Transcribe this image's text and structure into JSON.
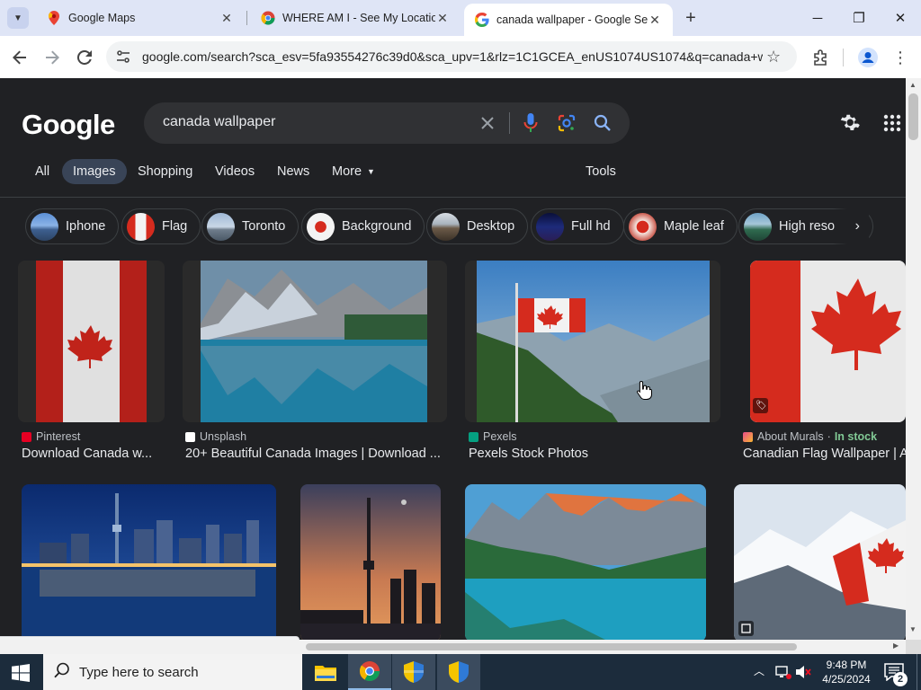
{
  "browser": {
    "tabs": [
      {
        "title": "Google Maps",
        "close": "✕",
        "active": false
      },
      {
        "title": "WHERE AM I - See My Location",
        "close": "✕",
        "active": false
      },
      {
        "title": "canada wallpaper - Google Search",
        "close": "✕",
        "active": true
      }
    ],
    "new_tab": "+",
    "window_controls": {
      "minimize": "─",
      "maximize": "❐",
      "close": "✕"
    },
    "url": "google.com/search?sca_esv=5fa93554276c39d0&sca_upv=1&rlz=1C1GCEA_enUS1074US1074&q=canada+w...",
    "status_url": "https://www.google.com/imgres?q=canada wallpaper&img..."
  },
  "google": {
    "logo": "Google",
    "query": "canada wallpaper",
    "nav_tabs": [
      "All",
      "Images",
      "Shopping",
      "Videos",
      "News",
      "More"
    ],
    "tools": "Tools",
    "chips": [
      "Iphone",
      "Flag",
      "Toronto",
      "Background",
      "Desktop",
      "Full hd",
      "Maple leaf",
      "High reso"
    ],
    "results_row1": [
      {
        "source": "Pinterest",
        "title": "Download Canada w..."
      },
      {
        "source": "Unsplash",
        "title": "20+ Beautiful Canada Images | Download ..."
      },
      {
        "source": "Pexels",
        "title": "Pexels Stock Photos"
      },
      {
        "source": "About Murals",
        "stock": "In stock",
        "title": "Canadian Flag Wallpaper | A"
      }
    ]
  },
  "taskbar": {
    "search_placeholder": "Type here to search",
    "time": "9:48 PM",
    "date": "4/25/2024",
    "notifications": "2"
  },
  "colors": {
    "page_bg": "#202124",
    "link_green": "#81c995",
    "canada_red": "#d52b1e",
    "tab_strip": "#dfe5f6"
  }
}
